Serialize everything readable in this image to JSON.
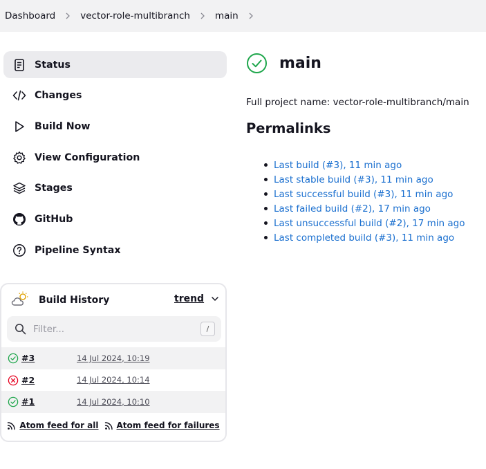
{
  "breadcrumb": [
    {
      "label": "Dashboard"
    },
    {
      "label": "vector-role-multibranch"
    },
    {
      "label": "main"
    }
  ],
  "tasks": [
    {
      "label": "Status",
      "icon": "document-icon",
      "active": true
    },
    {
      "label": "Changes",
      "icon": "code-icon"
    },
    {
      "label": "Build Now",
      "icon": "play-icon"
    },
    {
      "label": "View Configuration",
      "icon": "gear-icon"
    },
    {
      "label": "Stages",
      "icon": "layers-icon"
    },
    {
      "label": "GitHub",
      "icon": "github-icon"
    },
    {
      "label": "Pipeline Syntax",
      "icon": "help-circle-icon"
    }
  ],
  "build_history": {
    "title": "Build History",
    "trend_label": "trend",
    "filter_placeholder": "Filter...",
    "filter_shortcut": "/",
    "builds": [
      {
        "number": "#3",
        "date": "14 Jul 2024, 10:19",
        "status": "success"
      },
      {
        "number": "#2",
        "date": "14 Jul 2024, 10:14",
        "status": "failure"
      },
      {
        "number": "#1",
        "date": "14 Jul 2024, 10:10",
        "status": "success"
      }
    ],
    "feed_all": "Atom feed for all",
    "feed_failures": "Atom feed for failures"
  },
  "main": {
    "title": "main",
    "full_project_name": "Full project name: vector-role-multibranch/main",
    "permalinks_heading": "Permalinks",
    "permalinks": [
      "Last build (#3), 11 min ago",
      "Last stable build (#3), 11 min ago",
      "Last successful build (#3), 11 min ago",
      "Last failed build (#2), 17 min ago",
      "Last unsuccessful build (#2), 17 min ago",
      "Last completed build (#3), 11 min ago"
    ]
  },
  "colors": {
    "success": "#1ea64b",
    "failure": "#e6001f",
    "link": "#1a6fcf",
    "active_bg": "#ebebee"
  }
}
